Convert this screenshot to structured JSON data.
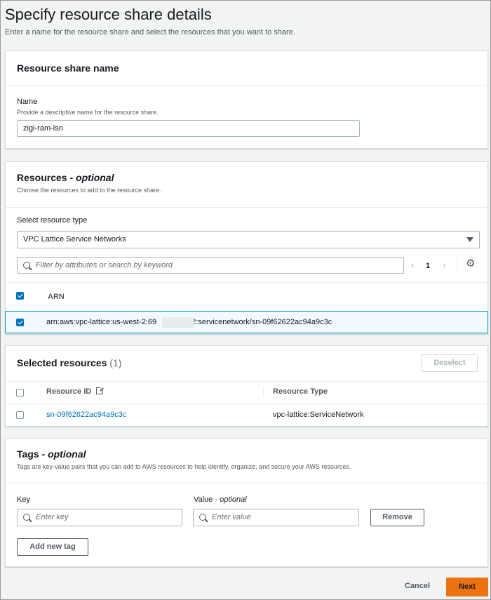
{
  "page": {
    "title": "Specify resource share details",
    "description": "Enter a name for the resource share and select the resources that you want to share."
  },
  "name_section": {
    "title": "Resource share name",
    "field_label": "Name",
    "field_hint": "Provide a descriptive name for the resource share.",
    "field_value": "zigi-ram-lsn"
  },
  "resources_section": {
    "title": "Resources - ",
    "title_optional": "optional",
    "description": "Choose the resources to add to the resource share.",
    "type_label": "Select resource type",
    "type_value": "VPC Lattice Service Networks",
    "filter_placeholder": "Filter by attributes or search by keyword",
    "page_number": "1",
    "column_arn": "ARN",
    "rows": [
      {
        "arn": "arn:aws:vpc-lattice:us-west-2:69        72:servicenetwork/sn-09f62622ac94a9c3c",
        "checked": true
      }
    ]
  },
  "selected_section": {
    "title": "Selected resources",
    "count": "(1)",
    "deselect_label": "Deselect",
    "column_id": "Resource ID",
    "column_type": "Resource Type",
    "rows": [
      {
        "id": "sn-09f62622ac94a9c3c",
        "type": "vpc-lattice:ServiceNetwork"
      }
    ]
  },
  "tags_section": {
    "title": "Tags - ",
    "title_optional": "optional",
    "description": "Tags are key-value pairs that you can add to AWS resources to help identify, organize, and secure your AWS resources.",
    "key_label": "Key",
    "value_label": "Value - ",
    "value_optional": "optional",
    "key_placeholder": "Enter key",
    "value_placeholder": "Enter value",
    "remove_label": "Remove",
    "add_label": "Add new tag"
  },
  "footer": {
    "cancel_label": "Cancel",
    "next_label": "Next"
  },
  "colors": {
    "accent": "#0073bb",
    "primary_button": "#ec7211",
    "selected_row_bg": "#f1faff"
  }
}
